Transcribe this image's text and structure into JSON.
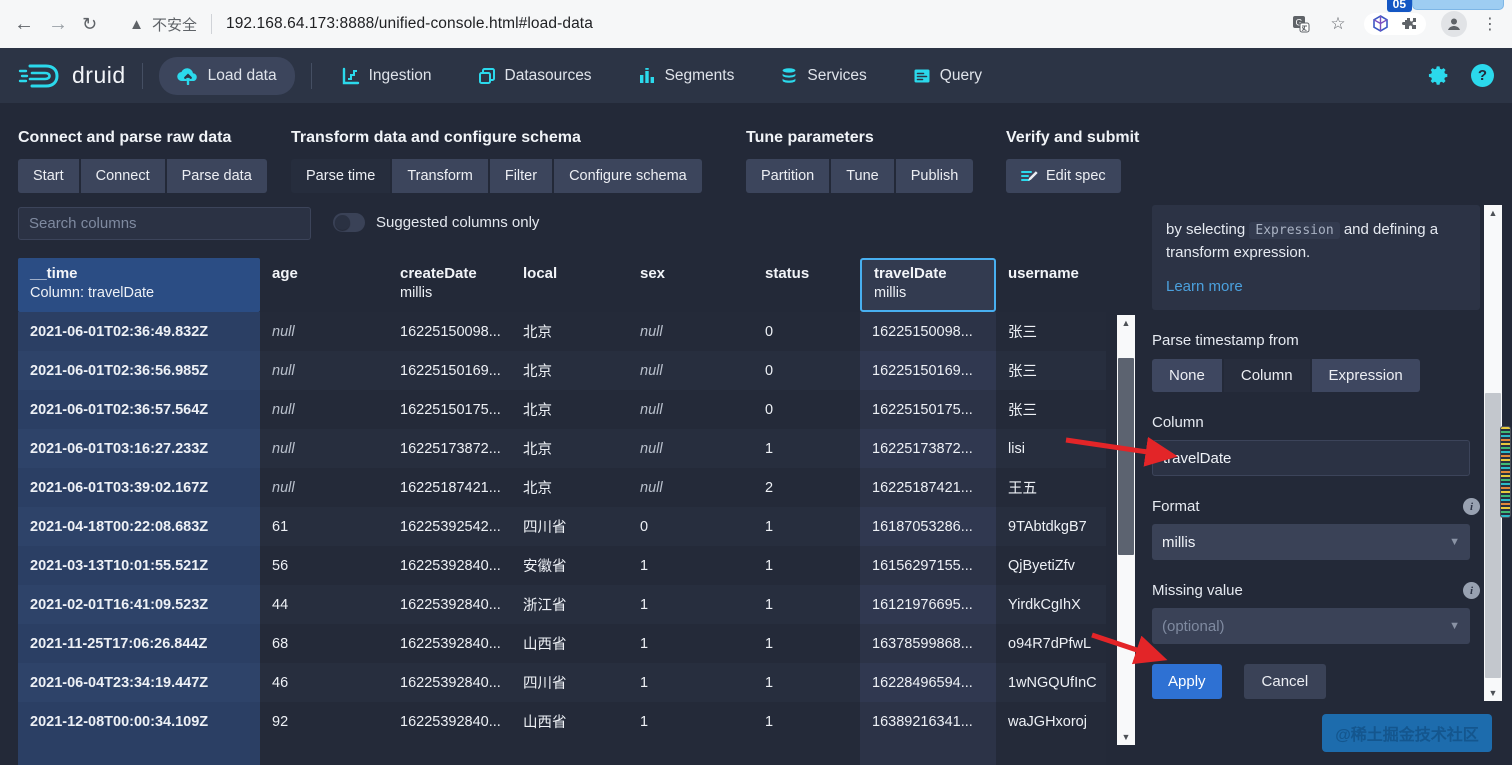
{
  "browser": {
    "security_label": "不安全",
    "url": "192.168.64.173:8888/unified-console.html#load-data",
    "overlay_badge": "05"
  },
  "navbar": {
    "brand": "druid",
    "items": [
      {
        "label": "Load data"
      },
      {
        "label": "Ingestion"
      },
      {
        "label": "Datasources"
      },
      {
        "label": "Segments"
      },
      {
        "label": "Services"
      },
      {
        "label": "Query"
      }
    ]
  },
  "steps": {
    "groups": [
      {
        "title": "Connect and parse raw data",
        "buttons": [
          "Start",
          "Connect",
          "Parse data"
        ]
      },
      {
        "title": "Transform data and configure schema",
        "buttons": [
          "Parse time",
          "Transform",
          "Filter",
          "Configure schema"
        ],
        "active": "Parse time"
      },
      {
        "title": "Tune parameters",
        "buttons": [
          "Partition",
          "Tune",
          "Publish"
        ]
      },
      {
        "title": "Verify and submit",
        "buttons": [
          "Edit spec"
        ]
      }
    ]
  },
  "controls": {
    "search_placeholder": "Search columns",
    "toggle_label": "Suggested columns only",
    "toggle_state": "off"
  },
  "table": {
    "columns": [
      {
        "name": "__time",
        "subtitle": "Column: travelDate"
      },
      {
        "name": "age",
        "subtitle": ""
      },
      {
        "name": "createDate",
        "subtitle": "millis"
      },
      {
        "name": "local",
        "subtitle": ""
      },
      {
        "name": "sex",
        "subtitle": ""
      },
      {
        "name": "status",
        "subtitle": ""
      },
      {
        "name": "travelDate",
        "subtitle": "millis",
        "selected": true
      },
      {
        "name": "username",
        "subtitle": ""
      }
    ],
    "rows": [
      [
        "2021-06-01T02:36:49.832Z",
        "null",
        "16225150098...",
        "北京",
        "null",
        "0",
        "16225150098...",
        "张三"
      ],
      [
        "2021-06-01T02:36:56.985Z",
        "null",
        "16225150169...",
        "北京",
        "null",
        "0",
        "16225150169...",
        "张三"
      ],
      [
        "2021-06-01T02:36:57.564Z",
        "null",
        "16225150175...",
        "北京",
        "null",
        "0",
        "16225150175...",
        "张三"
      ],
      [
        "2021-06-01T03:16:27.233Z",
        "null",
        "16225173872...",
        "北京",
        "null",
        "1",
        "16225173872...",
        "lisi"
      ],
      [
        "2021-06-01T03:39:02.167Z",
        "null",
        "16225187421...",
        "北京",
        "null",
        "2",
        "16225187421...",
        "王五"
      ],
      [
        "2021-04-18T00:22:08.683Z",
        "61",
        "16225392542...",
        "四川省",
        "0",
        "1",
        "16187053286...",
        "9TAbtdkgB7"
      ],
      [
        "2021-03-13T10:01:55.521Z",
        "56",
        "16225392840...",
        "安徽省",
        "1",
        "1",
        "16156297155...",
        "QjByetiZfv"
      ],
      [
        "2021-02-01T16:41:09.523Z",
        "44",
        "16225392840...",
        "浙江省",
        "1",
        "1",
        "16121976695...",
        "YirdkCgIhX"
      ],
      [
        "2021-11-25T17:06:26.844Z",
        "68",
        "16225392840...",
        "山西省",
        "1",
        "1",
        "16378599868...",
        "o94R7dPfwL"
      ],
      [
        "2021-06-04T23:34:19.447Z",
        "46",
        "16225392840...",
        "四川省",
        "1",
        "1",
        "16228496594...",
        "1wNGQUfInC"
      ],
      [
        "2021-12-08T00:00:34.109Z",
        "92",
        "16225392840...",
        "山西省",
        "1",
        "1",
        "16389216341...",
        "waJGHxoroj"
      ]
    ]
  },
  "panel": {
    "description_prefix": "by selecting ",
    "description_code": "Expression",
    "description_suffix": " and defining a transform expression.",
    "learn_more": "Learn more",
    "parse_from_label": "Parse timestamp from",
    "parse_options": [
      "None",
      "Column",
      "Expression"
    ],
    "parse_selected": "Column",
    "column_label": "Column",
    "column_value": "travelDate",
    "format_label": "Format",
    "format_value": "millis",
    "missing_label": "Missing value",
    "missing_placeholder": "(optional)",
    "apply_label": "Apply",
    "cancel_label": "Cancel"
  },
  "watermark": "@稀土掘金技术社区",
  "colors": {
    "accent_cyan": "#2bd9ec",
    "accent_blue": "#48aff0",
    "apply_blue": "#2e71d3",
    "time_column_header": "#2b4d84",
    "arrow_red": "#e32528"
  }
}
